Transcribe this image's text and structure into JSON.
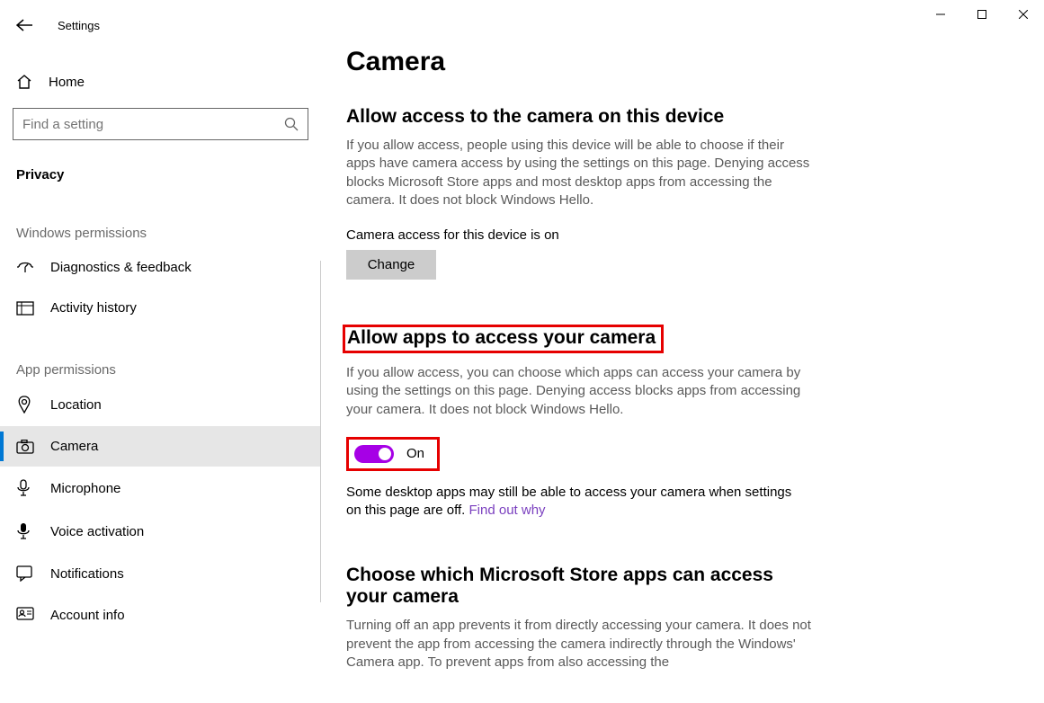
{
  "window": {
    "title": "Settings"
  },
  "sidebar": {
    "home": "Home",
    "search_placeholder": "Find a setting",
    "current_section": "Privacy",
    "group_windows": "Windows permissions",
    "group_app": "App permissions",
    "items_windows": [
      {
        "icon": "diagnostics-icon",
        "label": "Diagnostics & feedback"
      },
      {
        "icon": "history-icon",
        "label": "Activity history"
      }
    ],
    "items_app": [
      {
        "icon": "location-icon",
        "label": "Location"
      },
      {
        "icon": "camera-icon",
        "label": "Camera",
        "active": true
      },
      {
        "icon": "microphone-icon",
        "label": "Microphone"
      },
      {
        "icon": "voice-icon",
        "label": "Voice activation"
      },
      {
        "icon": "notifications-icon",
        "label": "Notifications"
      },
      {
        "icon": "account-icon",
        "label": "Account info"
      }
    ]
  },
  "main": {
    "title": "Camera",
    "section1": {
      "heading": "Allow access to the camera on this device",
      "desc": "If you allow access, people using this device will be able to choose if their apps have camera access by using the settings on this page. Denying access blocks Microsoft Store apps and most desktop apps from accessing the camera. It does not block Windows Hello.",
      "status": "Camera access for this device is on",
      "change_btn": "Change"
    },
    "section2": {
      "heading": "Allow apps to access your camera",
      "desc": "If you allow access, you can choose which apps can access your camera by using the settings on this page. Denying access blocks apps from accessing your camera. It does not block Windows Hello.",
      "toggle_state": "On",
      "note_pre": "Some desktop apps may still be able to access your camera when settings on this page are off. ",
      "note_link": "Find out why"
    },
    "section3": {
      "heading": "Choose which Microsoft Store apps can access your camera",
      "desc": "Turning off an app prevents it from directly accessing your camera. It does not prevent the app from accessing the camera indirectly through the Windows' Camera app. To prevent apps from also accessing the"
    }
  }
}
